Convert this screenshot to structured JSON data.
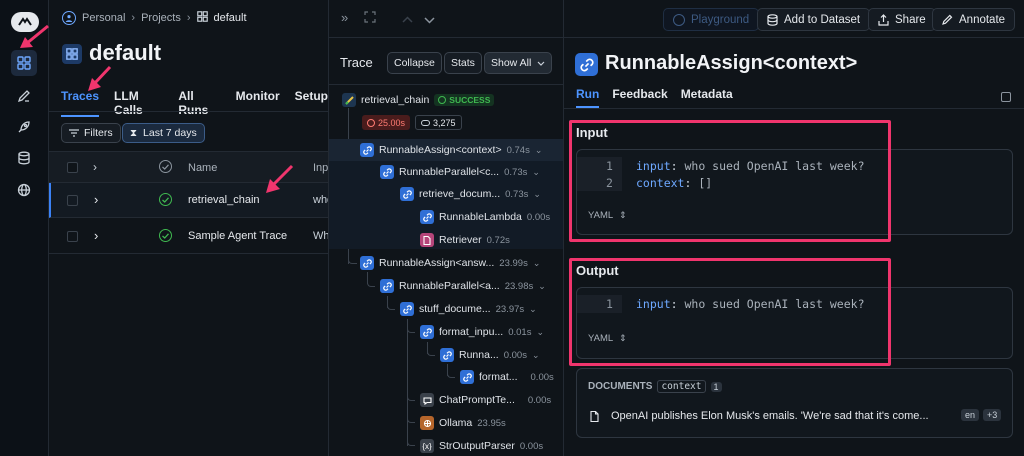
{
  "breadcrumb": {
    "workspace": "Personal",
    "projects": "Projects",
    "project": "default"
  },
  "project_title": "default",
  "project_tabs": [
    "Traces",
    "LLM Calls",
    "All Runs",
    "Monitor",
    "Setup"
  ],
  "filters": {
    "filters_label": "Filters",
    "date_label": "Last 7 days"
  },
  "table": {
    "headers": {
      "name": "Name",
      "input": "Inpu"
    },
    "rows": [
      {
        "name": "retrieval_chain",
        "input": "who"
      },
      {
        "name": "Sample Agent Trace",
        "input": "Wh"
      }
    ]
  },
  "trace": {
    "title": "Trace",
    "collapse_label": "Collapse",
    "stats_label": "Stats",
    "show_all_label": "Show All",
    "root": {
      "name": "retrieval_chain",
      "status": "SUCCESS",
      "latency": "25.00s",
      "tokens": "3,275"
    },
    "nodes": [
      {
        "name": "RunnableAssign<context>",
        "dur": "0.74s"
      },
      {
        "name": "RunnableParallel<c...",
        "dur": "0.73s"
      },
      {
        "name": "retrieve_docum...",
        "dur": "0.73s"
      },
      {
        "name": "RunnableLambda",
        "dur": "0.00s"
      },
      {
        "name": "Retriever",
        "dur": "0.72s"
      },
      {
        "name": "RunnableAssign<answ...",
        "dur": "23.99s"
      },
      {
        "name": "RunnableParallel<a...",
        "dur": "23.98s"
      },
      {
        "name": "stuff_docume...",
        "dur": "23.97s"
      },
      {
        "name": "format_inpu...",
        "dur": "0.01s"
      },
      {
        "name": "Runna...",
        "dur": "0.00s"
      },
      {
        "name": "format...",
        "dur": "0.00s"
      },
      {
        "name": "ChatPromptTe...",
        "dur": "0.00s"
      },
      {
        "name": "Ollama",
        "dur": "23.95s"
      },
      {
        "name": "StrOutputParser",
        "dur": "0.00s"
      }
    ]
  },
  "toolbar": {
    "playground_label": "Playground",
    "add_dataset_label": "Add to Dataset",
    "share_label": "Share",
    "annotate_label": "Annotate"
  },
  "run": {
    "title": "RunnableAssign<context>",
    "tabs": [
      "Run",
      "Feedback",
      "Metadata"
    ],
    "input": {
      "heading": "Input",
      "lines": [
        {
          "no": "1",
          "key": "input",
          "value": " who sued OpenAI last week?"
        },
        {
          "no": "2",
          "key": "context",
          "value": " []"
        }
      ],
      "format": "YAML"
    },
    "output": {
      "heading": "Output",
      "lines": [
        {
          "no": "1",
          "key": "input",
          "value": " who sued OpenAI last week?"
        }
      ],
      "format": "YAML"
    },
    "documents": {
      "label": "DOCUMENTS",
      "key": "context",
      "count": "1",
      "text": "OpenAI publishes Elon Musk's emails. 'We're sad that it's come...",
      "lang": "en",
      "more": "+3"
    }
  },
  "colors": {
    "accent": "#3b82f6",
    "highlight": "#f0356d",
    "success": "#3fb950"
  }
}
